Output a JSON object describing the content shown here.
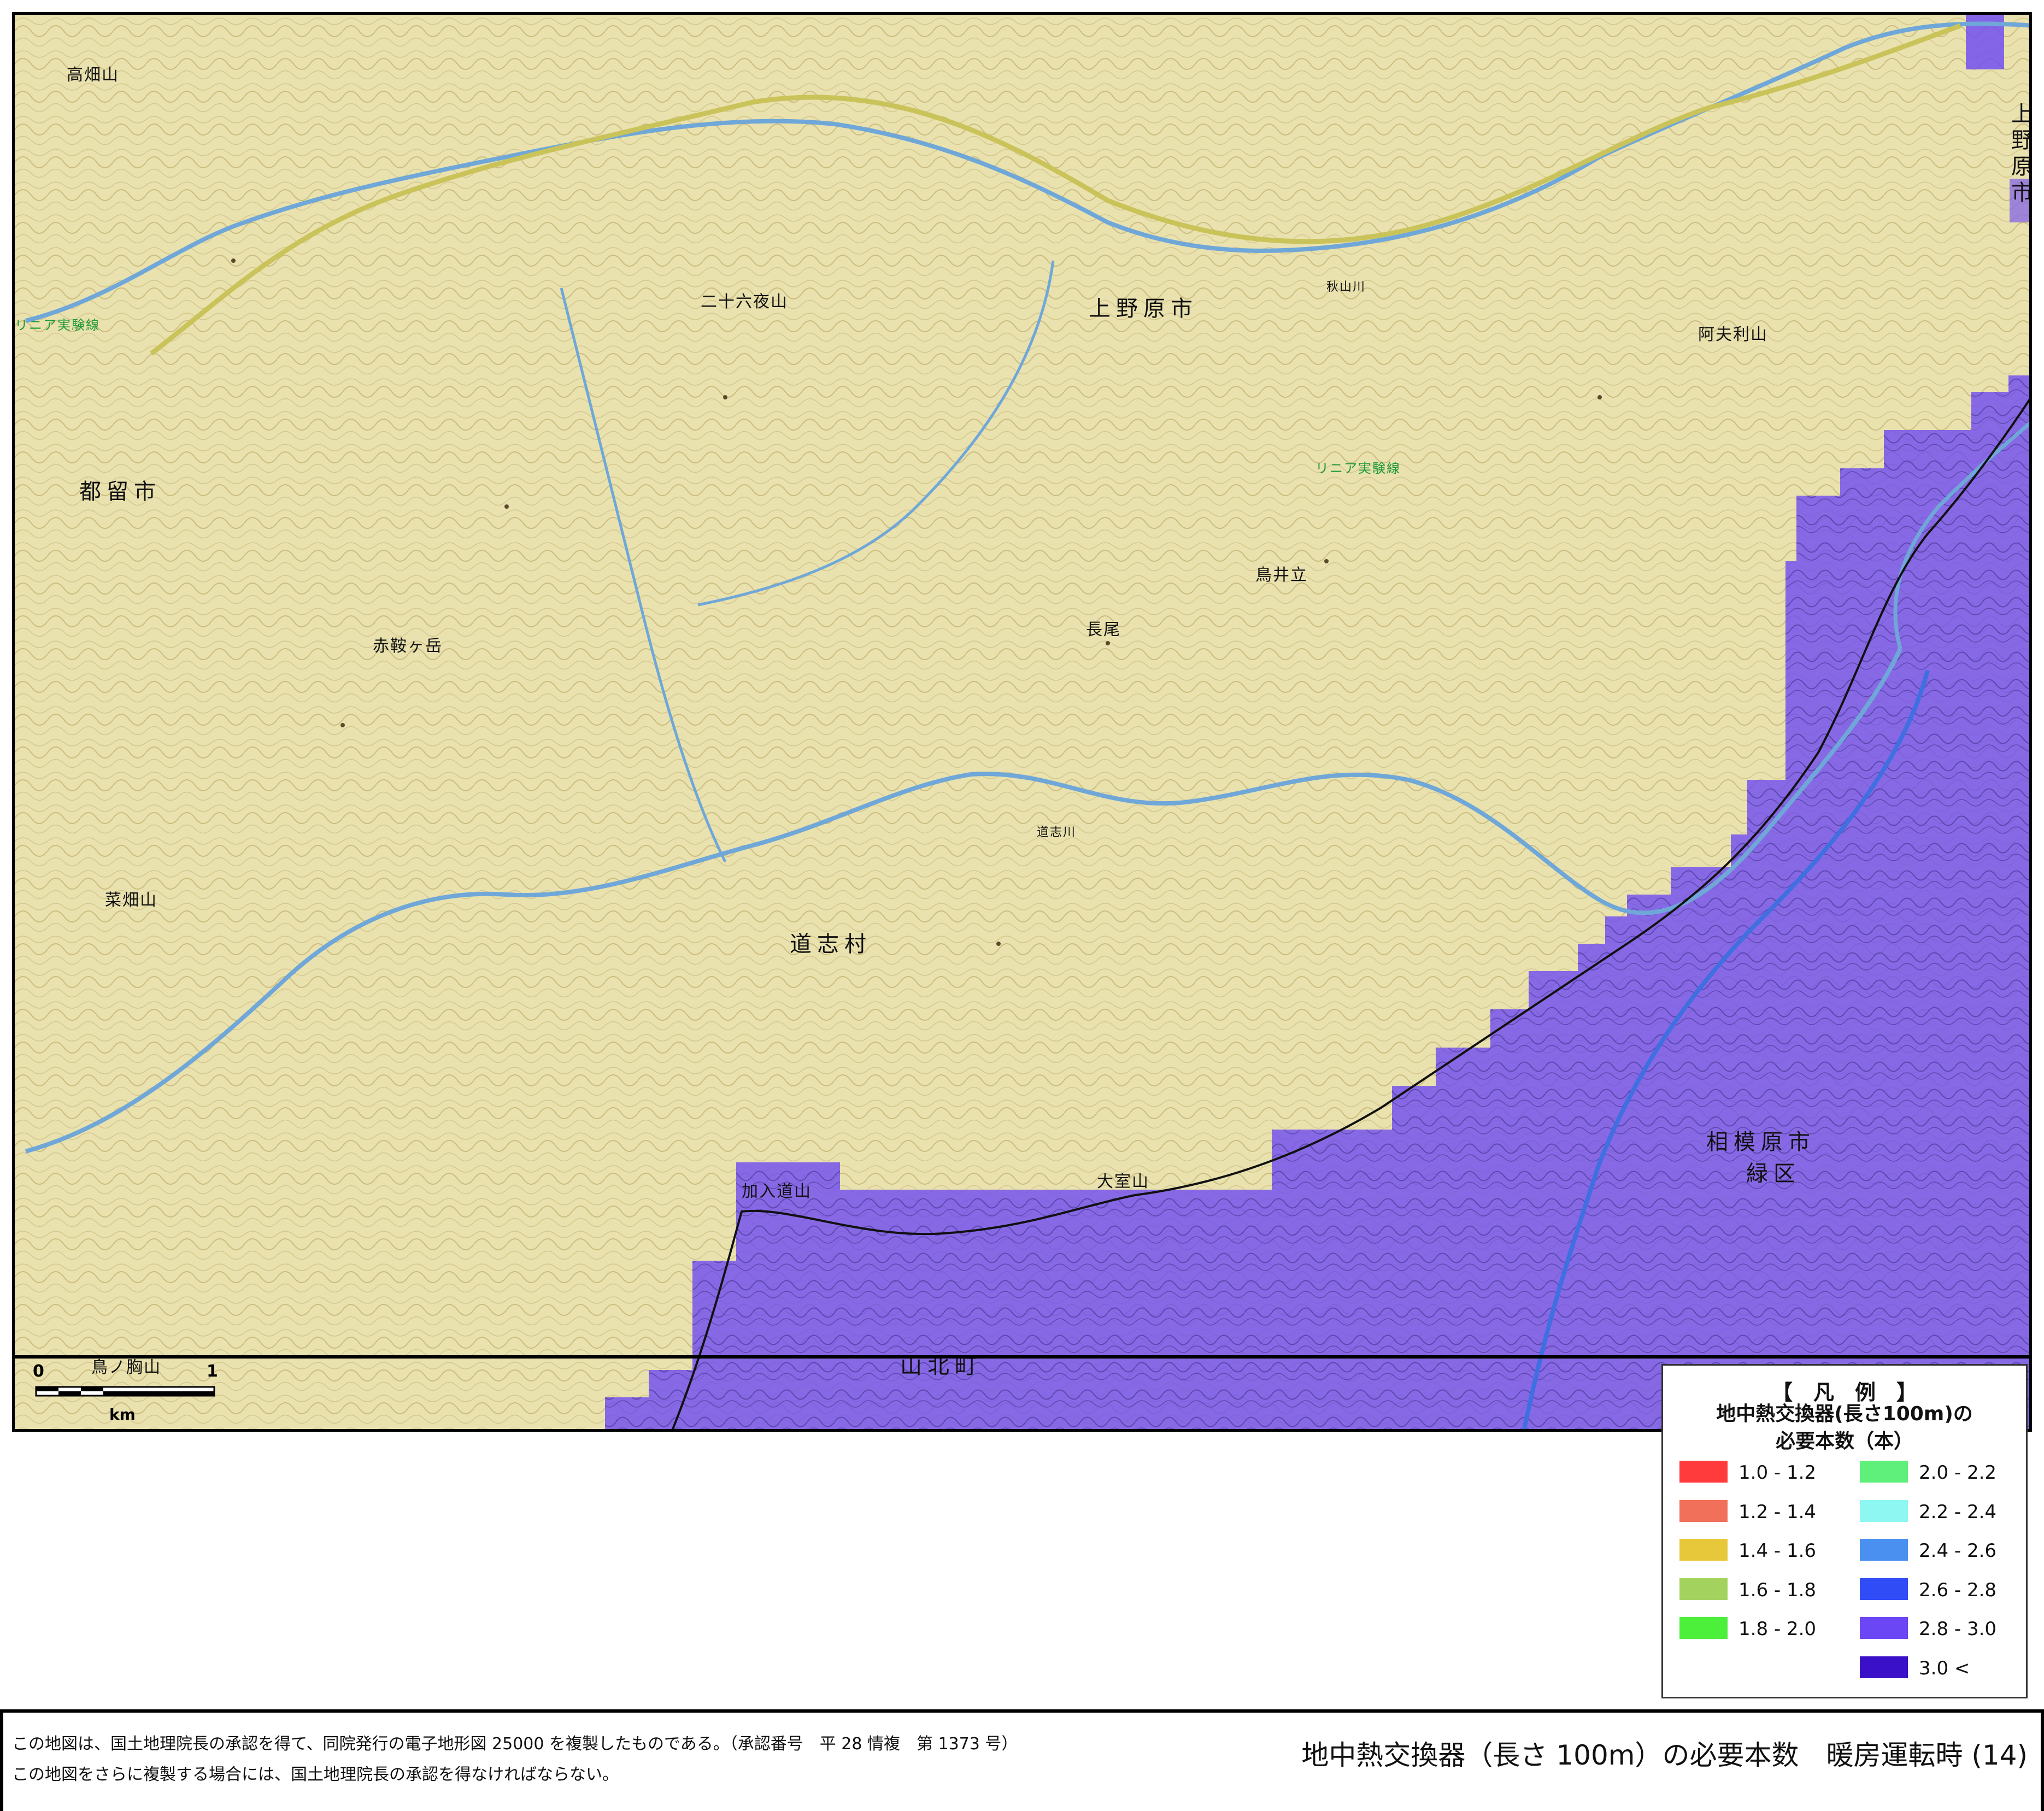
{
  "map": {
    "places": {
      "uenohara_city": "上野原市",
      "uenohara_edge": "上野原市",
      "tsuru_city": "都留市",
      "doshi_village": "道志村",
      "sagamihara_city": "相模原市",
      "midori_ward": "緑区",
      "yamakita_town": "山北町"
    },
    "mountains": {
      "nijurokuya": "二十六夜山",
      "akaboshi": "赤鞍ヶ岳",
      "torii": "鳥井立",
      "nagao": "長尾",
      "kanyudo": "加入道山",
      "omuro": "大室山",
      "nanbu": "菜畑山",
      "takazasu": "高畑山",
      "atsumi": "阿夫利山",
      "torinosu": "鳥ノ胸山"
    },
    "labels": {
      "linear_line_east": "リニア実験線",
      "linear_line_west": "リニア実験線",
      "akiyama_river": "秋山川",
      "doshi_river": "道志川"
    }
  },
  "scale_bar": {
    "zero": "0",
    "one": "1",
    "unit": "km"
  },
  "legend": {
    "title": "【　凡　例　】",
    "subtitle_line1": "地中熱交換器(長さ100m)の",
    "subtitle_line2": "必要本数（本）",
    "items": [
      {
        "label": "1.0  -  1.2",
        "color": "#ff3b3b"
      },
      {
        "label": "1.2  -  1.4",
        "color": "#f0705a"
      },
      {
        "label": "1.4  -  1.6",
        "color": "#e6c83a"
      },
      {
        "label": "1.6  -  1.8",
        "color": "#a3d35e"
      },
      {
        "label": "1.8  -  2.0",
        "color": "#4cf03a"
      },
      {
        "label": "2.0  -  2.2",
        "color": "#5ef07a"
      },
      {
        "label": "2.2  -  2.4",
        "color": "#8ef7f2"
      },
      {
        "label": "2.4  -  2.6",
        "color": "#4a90f0"
      },
      {
        "label": "2.6  -  2.8",
        "color": "#2f4cf7"
      },
      {
        "label": "2.8  -  3.0",
        "color": "#6b46f5"
      },
      {
        "label": "3.0 <",
        "color": "#3a10c9"
      }
    ]
  },
  "footer": {
    "note1": "この地図は、国土地理院長の承認を得て、同院発行の電子地形図 25000 を複製したものである。（承認番号　平 28 情複　第 1373 号）",
    "note2": "この地図をさらに複製する場合には、国土地理院長の承認を得なければならない。",
    "title": "地中熱交換器（長さ 100m）の必要本数　暖房運転時 (14)"
  },
  "colors": {
    "terrain": "#e9e1ae",
    "river": "#6fa7d8",
    "road": "#c9c35a",
    "overlay": "#6b46f5"
  }
}
